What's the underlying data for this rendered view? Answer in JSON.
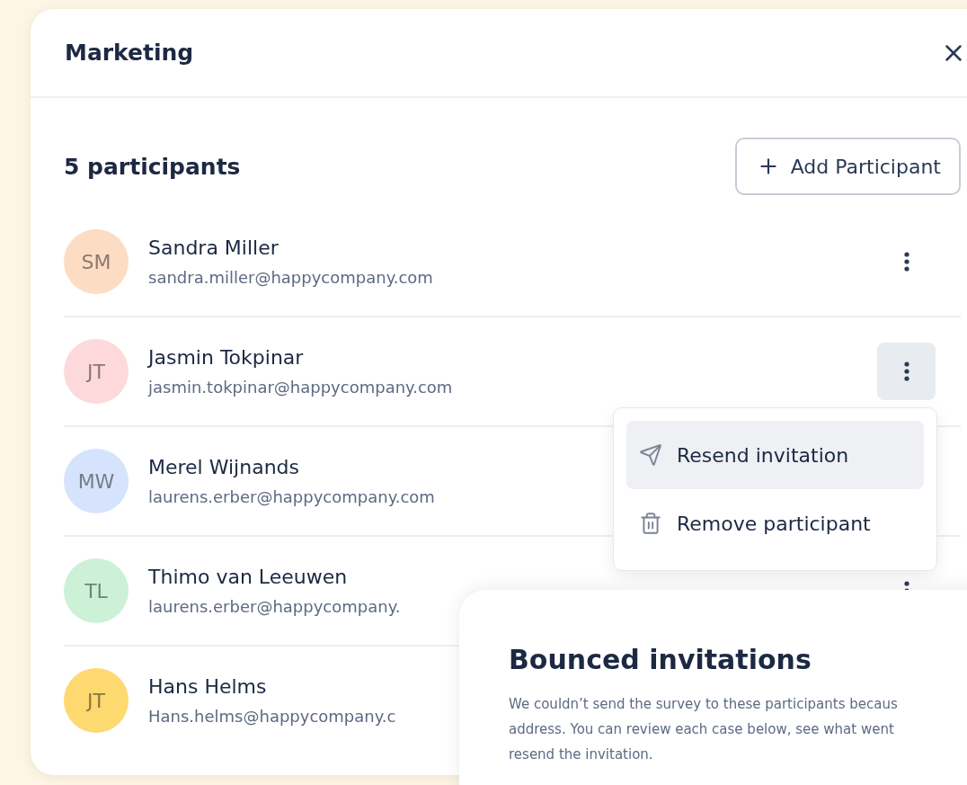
{
  "dialog": {
    "title": "Marketing"
  },
  "participants_header": {
    "count": "5 participants",
    "add_button": "Add Participant"
  },
  "participants": [
    {
      "initials": "SM",
      "name": "Sandra Miller",
      "email": "sandra.miller@happycompany.com",
      "color": "#fddcc4"
    },
    {
      "initials": "JT",
      "name": "Jasmin Tokpinar",
      "email": "jasmin.tokpinar@happycompany.com",
      "color": "#fdd9dc",
      "menu": {
        "items": [
          {
            "kind": "send",
            "label": "Resend invitation",
            "selected": true
          },
          {
            "kind": "trash",
            "label": "Remove participant",
            "selected": false
          }
        ]
      }
    },
    {
      "initials": "MW",
      "name": "Merel Wijnands",
      "email": "laurens.erber@happycompany.com",
      "color": "#d5e4fc"
    },
    {
      "initials": "TL",
      "name": "Thimo van Leeuwen",
      "email": "laurens.erber@happycompany.",
      "color": "#ccf1d6"
    },
    {
      "initials": "JT",
      "name": "Hans Helms",
      "email": "Hans.helms@happycompany.c",
      "color": "#fdd970"
    }
  ],
  "bounced_card": {
    "title": "Bounced invitations",
    "text_lines": [
      "We couldn’t send the survey to these participants becaus",
      "address. You can review each case below, see what went",
      "resend the invitation."
    ]
  }
}
